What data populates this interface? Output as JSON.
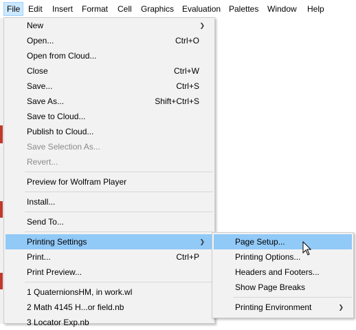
{
  "menubar": {
    "items": [
      "File",
      "Edit",
      "Insert",
      "Format",
      "Cell",
      "Graphics",
      "Evaluation",
      "Palettes",
      "Window",
      "Help"
    ]
  },
  "file_menu": {
    "items": [
      {
        "label": "New",
        "shortcut": "",
        "submenu": true
      },
      {
        "label": "Open...",
        "shortcut": "Ctrl+O"
      },
      {
        "label": "Open from Cloud...",
        "shortcut": ""
      },
      {
        "label": "Close",
        "shortcut": "Ctrl+W"
      },
      {
        "label": "Save...",
        "shortcut": "Ctrl+S"
      },
      {
        "label": "Save As...",
        "shortcut": "Shift+Ctrl+S"
      },
      {
        "label": "Save to Cloud...",
        "shortcut": ""
      },
      {
        "label": "Publish to Cloud...",
        "shortcut": ""
      },
      {
        "label": "Save Selection As...",
        "shortcut": "",
        "disabled": true
      },
      {
        "label": "Revert...",
        "shortcut": "",
        "disabled": true
      },
      {
        "label": "Preview for Wolfram Player",
        "shortcut": ""
      },
      {
        "label": "Install...",
        "shortcut": ""
      },
      {
        "label": "Send To...",
        "shortcut": ""
      },
      {
        "label": "Printing Settings",
        "shortcut": "",
        "submenu": true
      },
      {
        "label": "Print...",
        "shortcut": "Ctrl+P"
      },
      {
        "label": "Print Preview...",
        "shortcut": ""
      },
      {
        "label": "1 QuaternionsHM, in work.wl",
        "shortcut": ""
      },
      {
        "label": "2 Math 4145 H...or field.nb",
        "shortcut": ""
      },
      {
        "label": "3 Locator Exp.nb",
        "shortcut": ""
      }
    ]
  },
  "printing_submenu": {
    "items": [
      {
        "label": "Page Setup..."
      },
      {
        "label": "Printing Options..."
      },
      {
        "label": "Headers and Footers..."
      },
      {
        "label": "Show Page Breaks"
      },
      {
        "label": "Printing Environment",
        "submenu": true
      }
    ]
  },
  "icons": {
    "submenu_arrow": "chevron-right-icon",
    "cursor": "mouse-pointer-icon"
  }
}
